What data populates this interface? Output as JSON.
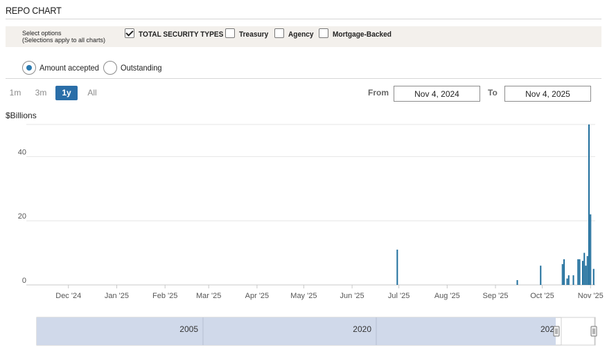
{
  "header": {
    "title": "REPO CHART"
  },
  "options": {
    "hint_line1": "Select options",
    "hint_line2": "(Selections apply to all charts)",
    "checkboxes": [
      {
        "label": "TOTAL SECURITY TYPES",
        "checked": true
      },
      {
        "label": "Treasury",
        "checked": false
      },
      {
        "label": "Agency",
        "checked": false
      },
      {
        "label": "Mortgage-Backed",
        "checked": false
      }
    ]
  },
  "view": {
    "radios": [
      {
        "label": "Amount accepted",
        "selected": true
      },
      {
        "label": "Outstanding",
        "selected": false
      }
    ]
  },
  "range": {
    "buttons": [
      {
        "label": "1m",
        "active": false
      },
      {
        "label": "3m",
        "active": false
      },
      {
        "label": "1y",
        "active": true
      },
      {
        "label": "All",
        "active": false
      }
    ],
    "from_label": "From",
    "from_value": "Nov 4, 2024",
    "to_label": "To",
    "to_value": "Nov 4, 2025"
  },
  "navigator": {
    "labels": [
      "2005",
      "2020",
      "202"
    ]
  },
  "colors": {
    "bar": "#1f6e9c",
    "grid": "#e6e6e6",
    "navigator_fill": "#d0d9ea",
    "accent": "#2a6ea8"
  },
  "chart_data": {
    "type": "bar",
    "title": "",
    "ylabel": "$Billions",
    "xlabel": "",
    "ylim": [
      0,
      50
    ],
    "yticks": [
      0,
      20,
      40
    ],
    "xlim": [
      "2024-11-04",
      "2025-11-04"
    ],
    "xticks": [
      {
        "label": "Dec '24",
        "date": "2024-12-01"
      },
      {
        "label": "Jan '25",
        "date": "2025-01-01"
      },
      {
        "label": "Feb '25",
        "date": "2025-02-01"
      },
      {
        "label": "Mar '25",
        "date": "2025-03-01"
      },
      {
        "label": "Apr '25",
        "date": "2025-04-01"
      },
      {
        "label": "May '25",
        "date": "2025-05-01"
      },
      {
        "label": "Jun '25",
        "date": "2025-06-01"
      },
      {
        "label": "Jul '25",
        "date": "2025-07-01"
      },
      {
        "label": "Aug '25",
        "date": "2025-08-01"
      },
      {
        "label": "Sep '25",
        "date": "2025-09-01"
      },
      {
        "label": "Oct '25",
        "date": "2025-10-01"
      },
      {
        "label": "Nov '25",
        "date": "2025-11-01"
      }
    ],
    "grid": true,
    "points": [
      {
        "date": "2025-06-30",
        "value": 11
      },
      {
        "date": "2025-09-15",
        "value": 1.5
      },
      {
        "date": "2025-09-30",
        "value": 6
      },
      {
        "date": "2025-10-14",
        "value": 6.5
      },
      {
        "date": "2025-10-15",
        "value": 8
      },
      {
        "date": "2025-10-17",
        "value": 2
      },
      {
        "date": "2025-10-18",
        "value": 3
      },
      {
        "date": "2025-10-21",
        "value": 3
      },
      {
        "date": "2025-10-24",
        "value": 8
      },
      {
        "date": "2025-10-25",
        "value": 8
      },
      {
        "date": "2025-10-27",
        "value": 7.5
      },
      {
        "date": "2025-10-28",
        "value": 10
      },
      {
        "date": "2025-10-29",
        "value": 6
      },
      {
        "date": "2025-10-30",
        "value": 9
      },
      {
        "date": "2025-10-31",
        "value": 50
      },
      {
        "date": "2025-11-01",
        "value": 22
      },
      {
        "date": "2025-11-03",
        "value": 5
      }
    ]
  }
}
